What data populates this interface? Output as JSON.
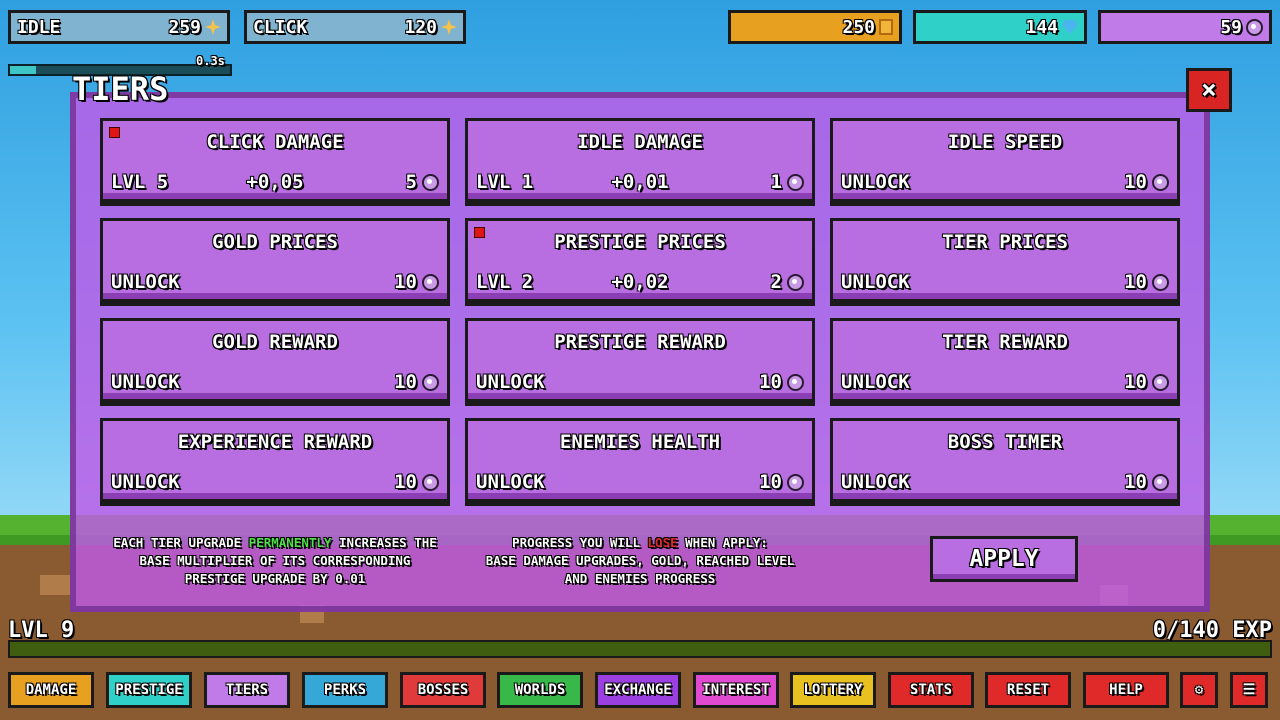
{
  "top": {
    "idle": {
      "label": "IDLE",
      "value": "259",
      "icon": "spark-icon"
    },
    "click": {
      "label": "CLICK",
      "value": "120",
      "icon": "spark-icon"
    },
    "gold": {
      "value": "250",
      "icon": "gold-coin-icon",
      "color": "#e8a020"
    },
    "gems": {
      "value": "144",
      "icon": "diamond-icon",
      "color": "#2fd0c8"
    },
    "prestige": {
      "value": "59",
      "icon": "prestige-orb-icon",
      "color": "#c07be8"
    },
    "timer_label": "0.3s",
    "timer_progress": 0.12
  },
  "panel": {
    "title": "TIERS",
    "close_label": "×",
    "cards": [
      {
        "title": "CLICK DAMAGE",
        "left": "LVL 5",
        "mid": "+0,05",
        "cost": "5",
        "flag": true
      },
      {
        "title": "IDLE DAMAGE",
        "left": "LVL 1",
        "mid": "+0,01",
        "cost": "1",
        "flag": false
      },
      {
        "title": "IDLE SPEED",
        "left": "UNLOCK",
        "mid": "",
        "cost": "10",
        "flag": false
      },
      {
        "title": "GOLD PRICES",
        "left": "UNLOCK",
        "mid": "",
        "cost": "10",
        "flag": false
      },
      {
        "title": "PRESTIGE PRICES",
        "left": "LVL 2",
        "mid": "+0,02",
        "cost": "2",
        "flag": true
      },
      {
        "title": "TIER PRICES",
        "left": "UNLOCK",
        "mid": "",
        "cost": "10",
        "flag": false
      },
      {
        "title": "GOLD REWARD",
        "left": "UNLOCK",
        "mid": "",
        "cost": "10",
        "flag": false
      },
      {
        "title": "PRESTIGE REWARD",
        "left": "UNLOCK",
        "mid": "",
        "cost": "10",
        "flag": false
      },
      {
        "title": "TIER REWARD",
        "left": "UNLOCK",
        "mid": "",
        "cost": "10",
        "flag": false
      },
      {
        "title": "EXPERIENCE REWARD",
        "left": "UNLOCK",
        "mid": "",
        "cost": "10",
        "flag": false
      },
      {
        "title": "ENEMIES HEALTH",
        "left": "UNLOCK",
        "mid": "",
        "cost": "10",
        "flag": false
      },
      {
        "title": "BOSS TIMER",
        "left": "UNLOCK",
        "mid": "",
        "cost": "10",
        "flag": false
      }
    ],
    "info_left": {
      "pre": "EACH TIER UPGRADE ",
      "highlight": "PERMANENTLY",
      "post": " INCREASES THE",
      "line2": "BASE MULTIPLIER OF ITS CORRESPONDING",
      "line3": "PRESTIGE UPGRADE BY 0.01"
    },
    "info_right": {
      "pre": "PROGRESS YOU WILL ",
      "highlight": "LOSE",
      "post": " WHEN APPLY:",
      "line2": "BASE DAMAGE UPGRADES, GOLD, REACHED LEVEL",
      "line3": "AND ENEMIES PROGRESS"
    },
    "apply_label": "APPLY"
  },
  "level": {
    "label": "LVL 9",
    "exp": "0/140 EXP"
  },
  "nav": [
    {
      "label": "DAMAGE",
      "color": "#e8a020",
      "name": "nav-damage"
    },
    {
      "label": "PRESTIGE",
      "color": "#2fd0c8",
      "name": "nav-prestige"
    },
    {
      "label": "TIERS",
      "color": "#c07be8",
      "name": "nav-tiers"
    },
    {
      "label": "PERKS",
      "color": "#35a8d8",
      "name": "nav-perks"
    },
    {
      "label": "BOSSES",
      "color": "#e03a3a",
      "name": "nav-bosses"
    },
    {
      "label": "WORLDS",
      "color": "#38b848",
      "name": "nav-worlds"
    },
    {
      "label": "EXCHANGE",
      "color": "#9b3fe0",
      "name": "nav-exchange"
    },
    {
      "label": "INTEREST",
      "color": "#e04ad0",
      "name": "nav-interest"
    },
    {
      "label": "LOTTERY",
      "color": "#e8c020",
      "name": "nav-lottery"
    },
    {
      "label": "STATS",
      "color": "#e02a2a",
      "name": "nav-stats"
    },
    {
      "label": "RESET",
      "color": "#e02a2a",
      "name": "nav-reset"
    },
    {
      "label": "HELP",
      "color": "#e02a2a",
      "name": "nav-help"
    },
    {
      "label": "⚙",
      "color": "#e02a2a",
      "name": "nav-settings"
    },
    {
      "label": "☰",
      "color": "#e02a2a",
      "name": "nav-menu"
    }
  ]
}
